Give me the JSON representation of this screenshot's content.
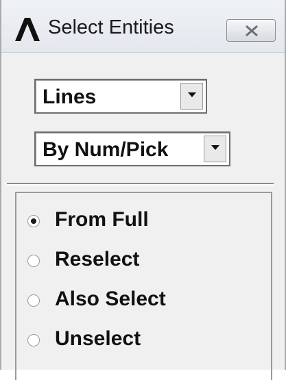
{
  "window": {
    "title": "Select Entities",
    "app_icon": "ansys-logo-icon",
    "close_icon": "close-icon"
  },
  "entity_type": {
    "selected": "Lines"
  },
  "selection_method": {
    "selected": "By Num/Pick"
  },
  "selection_mode": {
    "options": [
      {
        "label": "From Full",
        "checked": true
      },
      {
        "label": "Reselect",
        "checked": false
      },
      {
        "label": "Also Select",
        "checked": false
      },
      {
        "label": "Unselect",
        "checked": false
      }
    ]
  }
}
